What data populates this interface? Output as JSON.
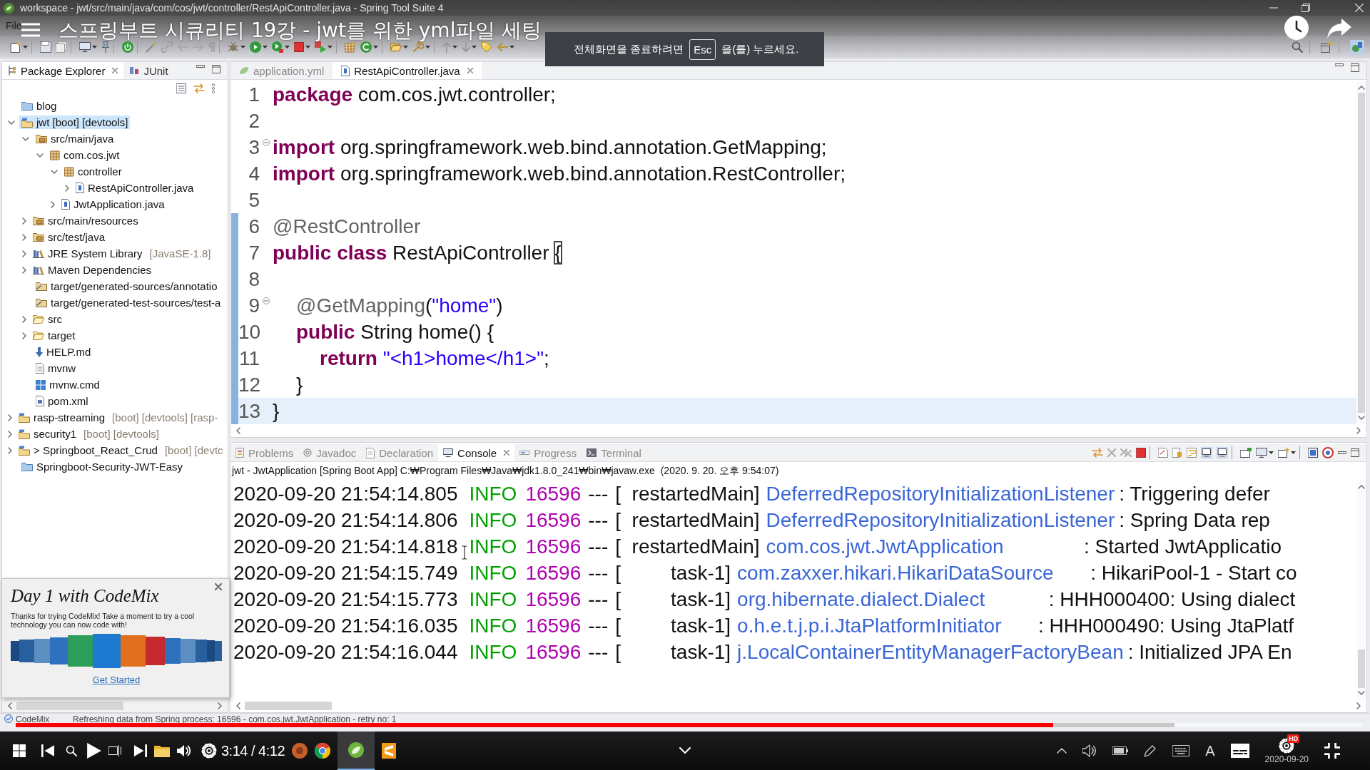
{
  "title_bar": {
    "title": "workspace - jwt/src/main/java/com/cos/jwt/controller/RestApiController.java - Spring Tool Suite 4"
  },
  "menu_bar": {
    "items": [
      "File"
    ]
  },
  "video_overlay": {
    "title": "스프링부트 시큐리티 19강 - jwt를 위한 yml파일 세팅",
    "notice": {
      "before": "전체화면을 종료하려면",
      "key": "Esc",
      "after": "을(를) 누르세요."
    }
  },
  "package_explorer": {
    "tabs": [
      {
        "label": "Package Explorer",
        "kind": "explorer",
        "selected": true
      },
      {
        "label": "JUnit",
        "kind": "junit",
        "selected": false
      }
    ],
    "tree": [
      {
        "label": "blog",
        "kind": "project",
        "selected": false
      },
      {
        "label": "jwt [boot] [devtools]",
        "kind": "boot-project",
        "expanded": true,
        "selected": true,
        "children": [
          {
            "label": "src/main/java",
            "kind": "source-folder",
            "expanded": true,
            "selected": false,
            "children": [
              {
                "label": "com.cos.jwt",
                "kind": "package",
                "expanded": true,
                "selected": false,
                "children": [
                  {
                    "label": "controller",
                    "kind": "package",
                    "expanded": true,
                    "selected": false,
                    "children": [
                      {
                        "label": "RestApiController.java",
                        "kind": "java",
                        "expanded": false,
                        "selected": false
                      }
                    ]
                  },
                  {
                    "label": "JwtApplication.java",
                    "kind": "java",
                    "expanded": false,
                    "selected": false
                  }
                ]
              }
            ]
          },
          {
            "label": "src/main/resources",
            "kind": "source-folder",
            "expanded": false,
            "selected": false
          },
          {
            "label": "src/test/java",
            "kind": "source-folder",
            "expanded": false,
            "selected": false
          },
          {
            "label": "JRE System Library",
            "decoration": "[JavaSE-1.8]",
            "kind": "library",
            "expanded": false,
            "selected": false
          },
          {
            "label": "Maven Dependencies",
            "kind": "library",
            "expanded": false,
            "selected": false
          },
          {
            "label": "target/generated-sources/annotatio",
            "kind": "generated-folder",
            "selected": false
          },
          {
            "label": "target/generated-test-sources/test-a",
            "kind": "generated-folder",
            "selected": false
          },
          {
            "label": "src",
            "kind": "folder",
            "expanded": false,
            "selected": false
          },
          {
            "label": "target",
            "kind": "folder",
            "expanded": false,
            "selected": false
          },
          {
            "label": "HELP.md",
            "kind": "markdown",
            "selected": false
          },
          {
            "label": "mvnw",
            "kind": "text-file",
            "selected": false
          },
          {
            "label": "mvnw.cmd",
            "kind": "windows-file",
            "selected": false
          },
          {
            "label": "pom.xml",
            "kind": "maven-file",
            "selected": false
          }
        ]
      },
      {
        "label": "rasp-streaming",
        "decoration": "[boot] [devtools] [rasp-",
        "kind": "boot-project",
        "expanded": false,
        "selected": false
      },
      {
        "label": "security1",
        "decoration": "[boot] [devtools]",
        "kind": "boot-project",
        "expanded": false,
        "selected": false
      },
      {
        "label": "> Springboot_React_Crud",
        "decoration": "[boot] [devtc",
        "kind": "boot-project",
        "expanded": false,
        "selected": false
      },
      {
        "label": "Springboot-Security-JWT-Easy",
        "kind": "project",
        "selected": false
      }
    ]
  },
  "editor": {
    "tabs": [
      {
        "label": "application.yml",
        "kind": "yaml",
        "selected": false
      },
      {
        "label": "RestApiController.java",
        "kind": "java",
        "selected": true
      }
    ],
    "lines": [
      {
        "number": "1",
        "tokens": [
          {
            "kind": "keyword",
            "text": "package"
          },
          {
            "kind": "plain",
            "text": " com.cos.jwt.controller;"
          }
        ],
        "fold_marker": false,
        "changed": false,
        "current": false
      },
      {
        "number": "2",
        "fold_marker": false,
        "changed": false,
        "current": false
      },
      {
        "number": "3",
        "tokens": [
          {
            "kind": "keyword",
            "text": "import"
          },
          {
            "kind": "plain",
            "text": " org.springframework.web.bind.annotation.GetMapping;"
          }
        ],
        "fold_marker": true,
        "changed": false,
        "current": false
      },
      {
        "number": "4",
        "tokens": [
          {
            "kind": "keyword",
            "text": "import"
          },
          {
            "kind": "plain",
            "text": " org.springframework.web.bind.annotation.RestController;"
          }
        ],
        "fold_marker": false,
        "changed": false,
        "current": false
      },
      {
        "number": "5",
        "fold_marker": false,
        "changed": false,
        "current": false
      },
      {
        "number": "6",
        "tokens": [
          {
            "kind": "annotation",
            "text": "@RestController"
          }
        ],
        "fold_marker": false,
        "changed": true,
        "current": false
      },
      {
        "number": "7",
        "tokens": [
          {
            "kind": "keyword",
            "text": "public class"
          },
          {
            "kind": "plain",
            "text": " RestApiController "
          },
          {
            "kind": "bracket-match",
            "text": "{"
          }
        ],
        "fold_marker": false,
        "changed": true,
        "current": false
      },
      {
        "number": "8",
        "fold_marker": false,
        "changed": true,
        "current": false
      },
      {
        "number": "9",
        "tokens": [
          {
            "kind": "annotation",
            "text": "\t@GetMapping"
          },
          {
            "kind": "plain",
            "text": "("
          },
          {
            "kind": "string",
            "text": "\"home\""
          },
          {
            "kind": "plain",
            "text": ")"
          }
        ],
        "fold_marker": true,
        "changed": true,
        "current": false
      },
      {
        "number": "10",
        "tokens": [
          {
            "kind": "keyword",
            "text": "\tpublic"
          },
          {
            "kind": "plain",
            "text": " String home() {"
          }
        ],
        "fold_marker": false,
        "changed": true,
        "current": false
      },
      {
        "number": "11",
        "tokens": [
          {
            "kind": "keyword",
            "text": "\t\treturn "
          },
          {
            "kind": "string",
            "text": "\"<h1>home</h1>\""
          },
          {
            "kind": "plain",
            "text": ";"
          }
        ],
        "fold_marker": false,
        "changed": true,
        "current": false
      },
      {
        "number": "12",
        "tokens": [
          {
            "kind": "plain",
            "text": "\t}"
          }
        ],
        "fold_marker": false,
        "changed": true,
        "current": false
      },
      {
        "number": "13",
        "tokens": [
          {
            "kind": "plain",
            "text": "}"
          }
        ],
        "fold_marker": false,
        "changed": true,
        "current": true
      }
    ]
  },
  "bottom_panel": {
    "tabs": [
      {
        "label": "Problems",
        "kind": "problems",
        "selected": false
      },
      {
        "label": "Javadoc",
        "kind": "javadoc",
        "selected": false
      },
      {
        "label": "Declaration",
        "kind": "declaration",
        "selected": false
      },
      {
        "label": "Console",
        "kind": "console",
        "selected": true
      },
      {
        "label": "Progress",
        "kind": "progress",
        "selected": false
      },
      {
        "label": "Terminal",
        "kind": "terminal",
        "selected": false
      }
    ],
    "console": {
      "header": "jwt - JwtApplication [Spring Boot App] C:₩Program Files₩Java₩jdk1.8.0_241₩bin₩javaw.exe  (2020. 9. 20. 오후 9:54:07)",
      "lines": [
        {
          "time": "2020-09-20 21:54:14.805",
          "level": "INFO",
          "pid": "16596",
          "separator": "---",
          "thread": "[  restartedMain]",
          "logger": "DeferredRepositoryInitializationListener",
          "message": ": Triggering defer"
        },
        {
          "time": "2020-09-20 21:54:14.806",
          "level": "INFO",
          "pid": "16596",
          "separator": "---",
          "thread": "[  restartedMain]",
          "logger": "DeferredRepositoryInitializationListener",
          "message": ": Spring Data rep"
        },
        {
          "time": "2020-09-20 21:54:14.818",
          "level": "INFO",
          "pid": "16596",
          "separator": "---",
          "thread": "[  restartedMain]",
          "logger": "com.cos.jwt.JwtApplication",
          "message": ": Started JwtApplicatio"
        },
        {
          "time": "2020-09-20 21:54:15.749",
          "level": "INFO",
          "pid": "16596",
          "separator": "---",
          "thread": "[         task-1]",
          "logger": "com.zaxxer.hikari.HikariDataSource",
          "message": ": HikariPool-1 - Start co"
        },
        {
          "time": "2020-09-20 21:54:15.773",
          "level": "INFO",
          "pid": "16596",
          "separator": "---",
          "thread": "[         task-1]",
          "logger": "org.hibernate.dialect.Dialect",
          "message": ": HHH000400: Using dialect"
        },
        {
          "time": "2020-09-20 21:54:16.035",
          "level": "INFO",
          "pid": "16596",
          "separator": "---",
          "thread": "[         task-1]",
          "logger": "o.h.e.t.j.p.i.JtaPlatformInitiator",
          "message": ": HHH000490: Using JtaPlatf"
        },
        {
          "time": "2020-09-20 21:54:16.044",
          "level": "INFO",
          "pid": "16596",
          "separator": "---",
          "thread": "[         task-1]",
          "logger": "j.LocalContainerEntityManagerFactoryBean",
          "message": ": Initialized JPA En"
        }
      ]
    }
  },
  "codemix_popup": {
    "title": "Day 1 with CodeMix",
    "text": "Thanks for trying CodeMix! Take a moment to try a cool technology you can now code with!",
    "link": "Get Started"
  },
  "status_bar": {
    "label": "CodeMix",
    "message": "Refreshing data from Spring process: 16596 - com.cos.jwt.JwtApplication - retry no: 1"
  },
  "player": {
    "progress": {
      "level": 0.77
    },
    "buffer": {
      "level": 0.86
    },
    "time": "3:14 / 4:12",
    "quality_badge": "HD"
  },
  "taskbar": {
    "input_indicator": "A",
    "date": "2020-09-20"
  }
}
